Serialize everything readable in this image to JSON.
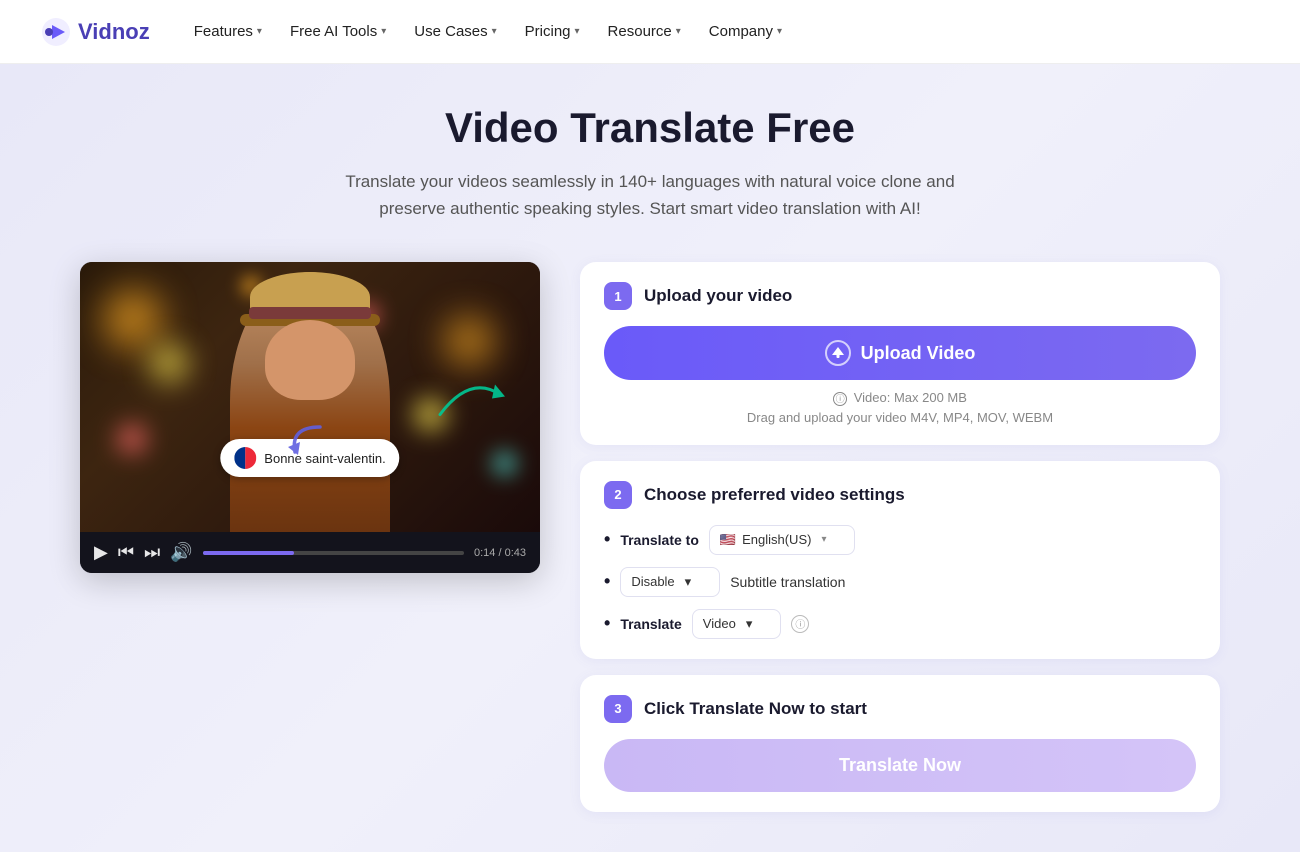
{
  "brand": {
    "name": "Vidnoz",
    "logo_text": "Vidnoz"
  },
  "navbar": {
    "items": [
      {
        "label": "Features",
        "has_dropdown": true
      },
      {
        "label": "Free AI Tools",
        "has_dropdown": true
      },
      {
        "label": "Use Cases",
        "has_dropdown": true
      },
      {
        "label": "Pricing",
        "has_dropdown": true
      },
      {
        "label": "Resource",
        "has_dropdown": true
      },
      {
        "label": "Company",
        "has_dropdown": true
      }
    ]
  },
  "hero": {
    "title": "Video Translate Free",
    "subtitle": "Translate your videos seamlessly in 140+ languages with natural voice clone and preserve authentic speaking styles. Start smart video translation with AI!"
  },
  "video": {
    "subtitle_text": "Bonne saint-valentin.",
    "time_current": "0:14",
    "time_total": "0:43"
  },
  "steps": [
    {
      "number": "1",
      "title": "Upload your video",
      "upload_button": "Upload Video",
      "max_size": "Video: Max 200 MB",
      "drag_text": "Drag and upload your video M4V, MP4, MOV, WEBM"
    },
    {
      "number": "2",
      "title": "Choose preferred video settings",
      "settings": [
        {
          "label": "Translate to",
          "value": "English(US)",
          "flag": "🇺🇸"
        },
        {
          "prefix": "Disable",
          "suffix": "Subtitle translation"
        },
        {
          "label": "Translate",
          "value": "Video"
        }
      ]
    },
    {
      "number": "3",
      "title": "Click Translate Now to start",
      "button_label": "Translate Now"
    }
  ],
  "colors": {
    "primary": "#6a5af9",
    "step_bg": "#7c6af0",
    "translate_btn": "#c9b8f5"
  }
}
